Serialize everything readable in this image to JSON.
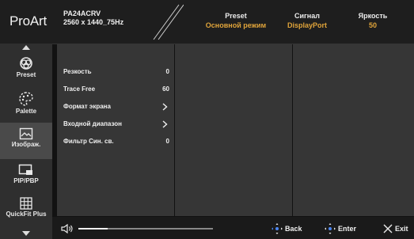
{
  "header": {
    "brand": "ProArt",
    "model_name": "PA24ACRV",
    "resolution": "2560 x 1440_75Hz",
    "status": [
      {
        "title": "Preset",
        "value": "Основной режим"
      },
      {
        "title": "Сигнал",
        "value": "DisplayPort"
      },
      {
        "title": "Яркость",
        "value": "50"
      }
    ]
  },
  "sidebar": {
    "items": [
      {
        "label": "Preset",
        "icon": "preset-icon"
      },
      {
        "label": "Palette",
        "icon": "palette-icon"
      },
      {
        "label": "Изображ.",
        "icon": "image-icon",
        "active": true
      },
      {
        "label": "PIP/PBP",
        "icon": "pip-icon"
      },
      {
        "label": "QuickFit Plus",
        "icon": "grid-icon"
      }
    ]
  },
  "menu": {
    "rows": [
      {
        "label": "Резкость",
        "value": "0"
      },
      {
        "label": "Trace Free",
        "value": "60"
      },
      {
        "label": "Формат экрана",
        "value": ""
      },
      {
        "label": "Входной диапазон",
        "value": ""
      },
      {
        "label": "Фильтр Син. св.",
        "value": "0"
      }
    ]
  },
  "footer": {
    "volume_level": 0.22,
    "back_label": "Back",
    "enter_label": "Enter",
    "exit_label": "Exit"
  },
  "colors": {
    "accent": "#e0a43a",
    "panel": "#363636",
    "sidebar": "#2f2f2f",
    "active": "#4a4a4a"
  }
}
